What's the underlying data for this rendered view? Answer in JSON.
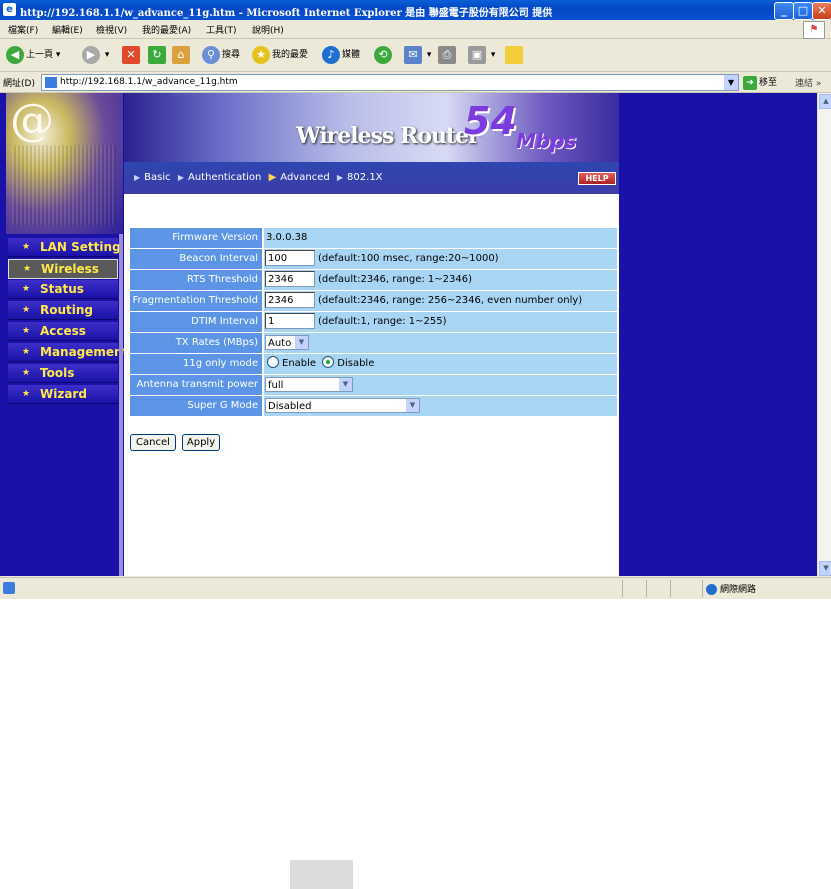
{
  "window": {
    "title": "http://192.168.1.1/w_advance_11g.htm - Microsoft Internet Explorer 是由 聯盛電子股份有限公司 提供",
    "controls": {
      "minimize": "_",
      "maximize": "□",
      "close": "✕"
    }
  },
  "menu": [
    "檔案(F)",
    "編輯(E)",
    "檢視(V)",
    "我的最愛(A)",
    "工具(T)",
    "說明(H)"
  ],
  "toolbar": {
    "back": "上一頁",
    "search": "搜尋",
    "favorites": "我的最愛",
    "media": "媒體"
  },
  "address": {
    "label": "網址(D)",
    "url": "http://192.168.1.1/w_advance_11g.htm",
    "go": "移至",
    "links": "連結"
  },
  "nav": {
    "items": [
      {
        "label": "LAN Setting"
      },
      {
        "label": "Wireless"
      },
      {
        "label": "Status"
      },
      {
        "label": "Routing"
      },
      {
        "label": "Access"
      },
      {
        "label": "Management"
      },
      {
        "label": "Tools"
      },
      {
        "label": "Wizard"
      }
    ],
    "active": "Wireless"
  },
  "banner": {
    "product": "Wireless Router",
    "speed": "54",
    "unit": "Mbps"
  },
  "tabs": {
    "items": [
      "Basic",
      "Authentication",
      "Advanced",
      "802.1X"
    ],
    "active": "Advanced",
    "help": "HELP"
  },
  "settings": {
    "firmware": {
      "label": "Firmware Version",
      "value": "3.0.0.38"
    },
    "beacon": {
      "label": "Beacon Interval",
      "value": "100",
      "hint": "(default:100 msec, range:20~1000)"
    },
    "rts": {
      "label": "RTS Threshold",
      "value": "2346",
      "hint": "(default:2346, range: 1~2346)"
    },
    "frag": {
      "label": "Fragmentation Threshold",
      "value": "2346",
      "hint": "(default:2346, range: 256~2346, even number only)"
    },
    "dtim": {
      "label": "DTIM Interval",
      "value": "1",
      "hint": "(default:1, range: 1~255)"
    },
    "txrates": {
      "label": "TX Rates (MBps)",
      "value": "Auto"
    },
    "only11g": {
      "label": "11g only mode",
      "enable": "Enable",
      "disable": "Disable",
      "selected": "Disable"
    },
    "antenna": {
      "label": "Antenna transmit power",
      "value": "full"
    },
    "superg": {
      "label": "Super G Mode",
      "value": "Disabled"
    }
  },
  "buttons": {
    "cancel": "Cancel",
    "apply": "Apply"
  },
  "status": {
    "zone": "網際網路"
  }
}
